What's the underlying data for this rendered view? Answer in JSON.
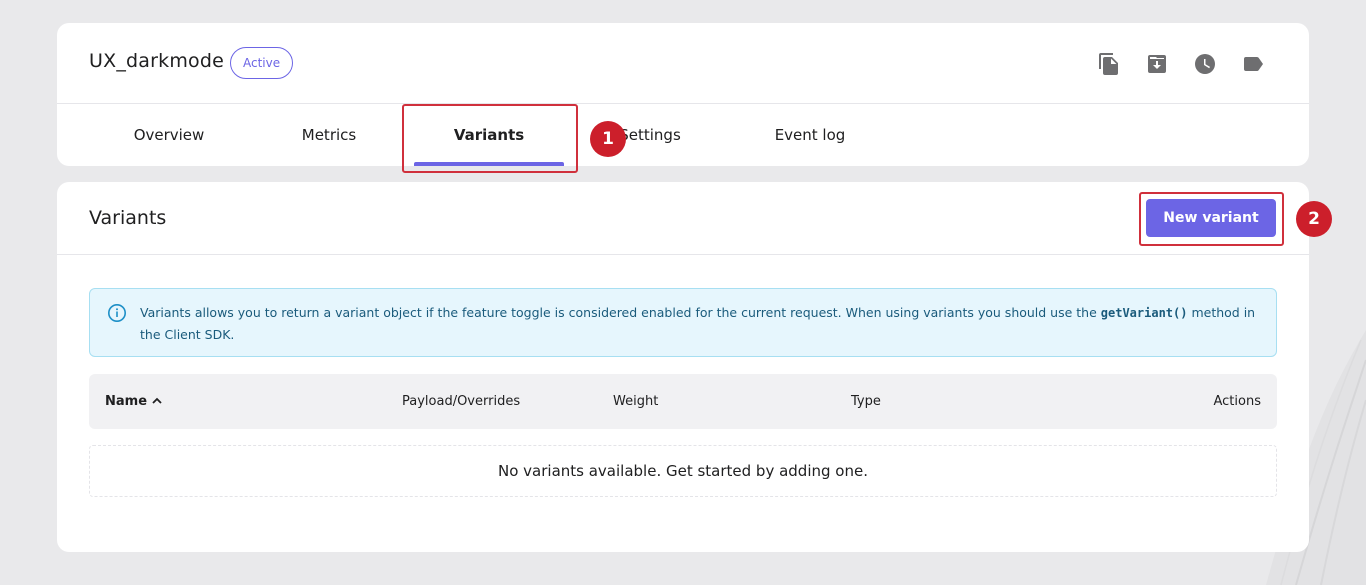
{
  "feature": {
    "name": "UX_darkmode",
    "status": "Active"
  },
  "header_actions": [
    {
      "icon": "copy-icon"
    },
    {
      "icon": "archive-icon"
    },
    {
      "icon": "clock-icon"
    },
    {
      "icon": "tag-icon"
    }
  ],
  "tabs": [
    {
      "label": "Overview"
    },
    {
      "label": "Metrics"
    },
    {
      "label": "Variants",
      "active": true
    },
    {
      "label": "Settings"
    },
    {
      "label": "Event log"
    }
  ],
  "step_markers": [
    "1",
    "2"
  ],
  "variants": {
    "title": "Variants",
    "new_button_label": "New variant",
    "info": {
      "text_before": "Variants allows you to return a variant object if the feature toggle is considered enabled for the current request. When using variants you should use the ",
      "code": "getVariant()",
      "text_after": " method in the Client SDK."
    },
    "table": {
      "columns": [
        "Name",
        "Payload/Overrides",
        "Weight",
        "Type",
        "Actions"
      ],
      "empty_message": "No variants available. Get started by adding one."
    }
  },
  "colors": {
    "accent": "#6c65e5",
    "marker_red": "#cc1f2b",
    "info_bg": "#e6f6fd"
  }
}
